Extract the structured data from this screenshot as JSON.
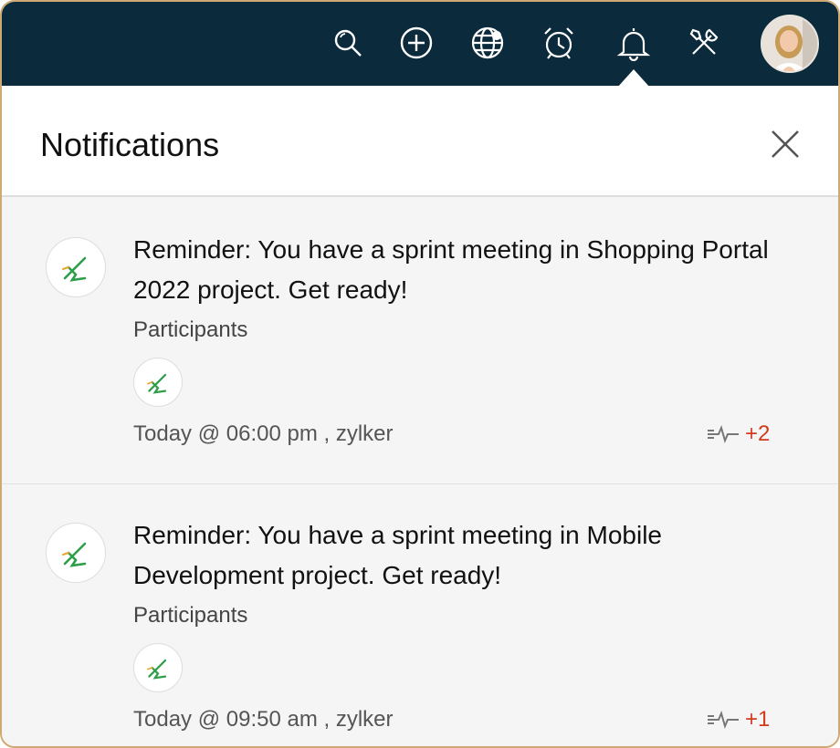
{
  "topbar": {
    "icons": [
      "search-icon",
      "add-icon",
      "globe-icon",
      "alarm-clock-icon",
      "bell-icon",
      "tools-icon"
    ],
    "avatar": "user-avatar"
  },
  "panel": {
    "title": "Notifications"
  },
  "notifications": [
    {
      "icon": "project-pen-icon",
      "message": "Reminder: You have a sprint meeting in Shopping Portal 2022  project. Get ready!",
      "participants_label": "Participants",
      "meta": "Today @ 06:00 pm , zylker",
      "activity_count": "+2"
    },
    {
      "icon": "project-pen-icon",
      "message": "Reminder: You have a sprint meeting in Mobile Development project. Get ready!",
      "participants_label": "Participants",
      "meta": "Today @ 09:50 am , zylker",
      "activity_count": "+1"
    }
  ],
  "colors": {
    "topbar": "#0b2a3b",
    "frame_border": "#cfa874",
    "accent_count": "#d13b1c",
    "icon_green": "#2e9e4a"
  }
}
